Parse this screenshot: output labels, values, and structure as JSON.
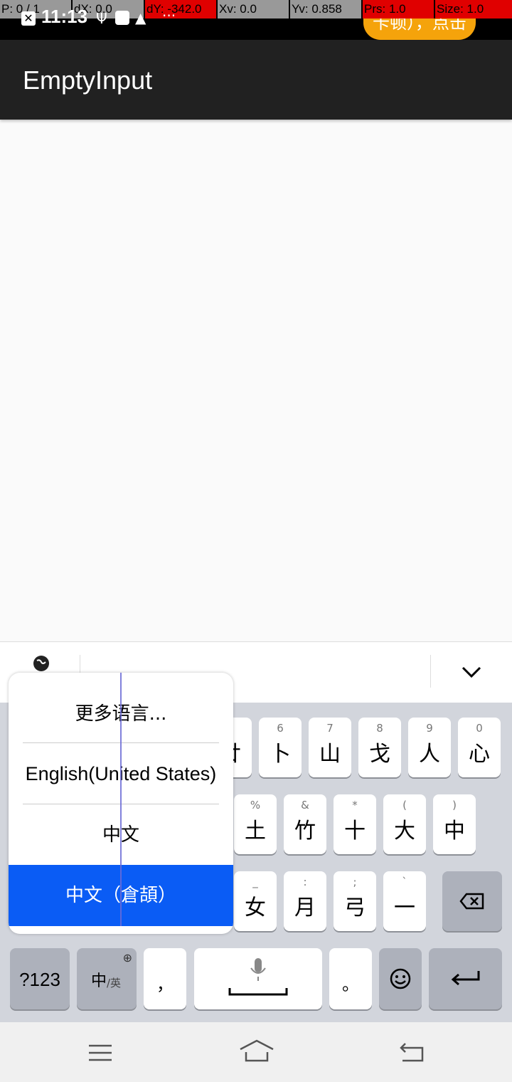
{
  "debug_bar": {
    "p": "P: 0 / 1",
    "dx": "dX: 0.0",
    "dy": "dY: -342.0",
    "xv": "Xv: 0.0",
    "yv": "Yv: 0.858",
    "prs": "Prs: 1.0",
    "size": "Size: 1.0"
  },
  "status_bar": {
    "time": "11:13",
    "notification_pill": "卡顿），点击"
  },
  "app_bar": {
    "title": "EmptyInput"
  },
  "keyboard": {
    "row1": [
      {
        "hint": "6",
        "label": "卜"
      },
      {
        "hint": "7",
        "label": "山"
      },
      {
        "hint": "8",
        "label": "戈"
      },
      {
        "hint": "9",
        "label": "人"
      },
      {
        "hint": "0",
        "label": "心"
      }
    ],
    "row1_partial_label": "廿",
    "row2": [
      {
        "hint": "%",
        "label": "土"
      },
      {
        "hint": "&",
        "label": "竹"
      },
      {
        "hint": "*",
        "label": "十"
      },
      {
        "hint": "(",
        "label": "大"
      },
      {
        "hint": ")",
        "label": "中"
      }
    ],
    "row3": [
      {
        "hint": "_",
        "label": "女"
      },
      {
        "hint": ":",
        "label": "月"
      },
      {
        "hint": ";",
        "label": "弓"
      },
      {
        "hint": "`",
        "label": "一"
      }
    ],
    "bottom": {
      "symbols": "?123",
      "lang_main": "中",
      "lang_sub": "/英",
      "comma": "，",
      "period": "。"
    }
  },
  "language_popup": {
    "items": [
      {
        "label": "更多语言..."
      },
      {
        "label": "English(United States)"
      },
      {
        "label": "中文"
      },
      {
        "label": "中文（倉頡）",
        "selected": true
      }
    ]
  },
  "colors": {
    "app_bar": "#212121",
    "selected": "#0a5cf5",
    "pill": "#f5a30b"
  }
}
